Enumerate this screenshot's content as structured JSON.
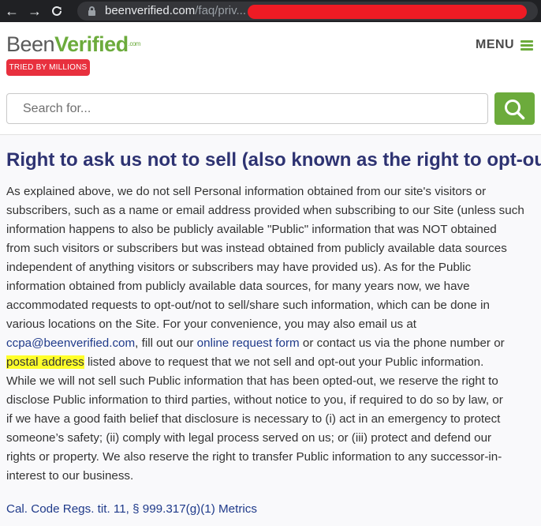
{
  "browser": {
    "back_glyph": "←",
    "forward_glyph": "→",
    "reload_glyph": "C",
    "url_host": "beenverified.com",
    "url_path": "/faq/priv..."
  },
  "header": {
    "logo_been": "Been",
    "logo_verified": "Verified",
    "logo_com": ".com",
    "tagline": "TRIED BY MILLIONS",
    "menu_label": "MENU"
  },
  "search": {
    "placeholder": "Search for...",
    "value": ""
  },
  "article": {
    "heading": "Right to ask us not to sell (also known as the right to opt-out).",
    "lines": [
      "As explained above, we do not sell Personal information obtained from our site's visitors or",
      "subscribers, such as a name or email address provided when subscribing to our Site (unless such",
      "information happens to also be publicly available \"Public\" information that was NOT obtained",
      "from such visitors or subscribers but was instead obtained from publicly available data sources",
      "independent of anything visitors or subscribers may have provided us). As for the Public",
      "information obtained from publicly available data sources, for many years now, we have",
      "accommodated requests to opt-out/not to sell/share such information, which can be done in",
      "various locations on the Site. For your convenience, you may also email us at"
    ],
    "line9": {
      "email": "ccpa@beenverified.com",
      "text_a": ", fill out our ",
      "form_link": "online request form",
      "text_b": " or contact us via the phone number or"
    },
    "line10": {
      "highlight": "postal address",
      "text": " listed above to request that we not sell and opt-out your Public information."
    },
    "lines_after": [
      "While we will not sell such Public information that has been opted-out, we reserve the right to",
      "disclose Public information to third parties, without notice to you, if required to do so by law, or",
      "if we have a good faith belief that disclosure is necessary to (i) act in an emergency to protect",
      "someone’s safety; (ii) comply with legal process served on us; or (iii) protect and defend our",
      "rights or property. We also reserve the right to transfer Public information to any successor-in-",
      "interest to our business."
    ],
    "footer_link": "Cal. Code Regs. tit. 11, § 999.317(g)(1) Metrics"
  },
  "colors": {
    "brand_green": "#6cab3c",
    "tagline_red": "#e8303e",
    "heading_navy": "#2e3372",
    "link_blue": "#1f3a8a",
    "highlight_yellow": "#ffff2a"
  },
  "icons": {
    "search": "magnifier-icon",
    "menu": "hamburger-icon",
    "lock": "lock-icon"
  }
}
